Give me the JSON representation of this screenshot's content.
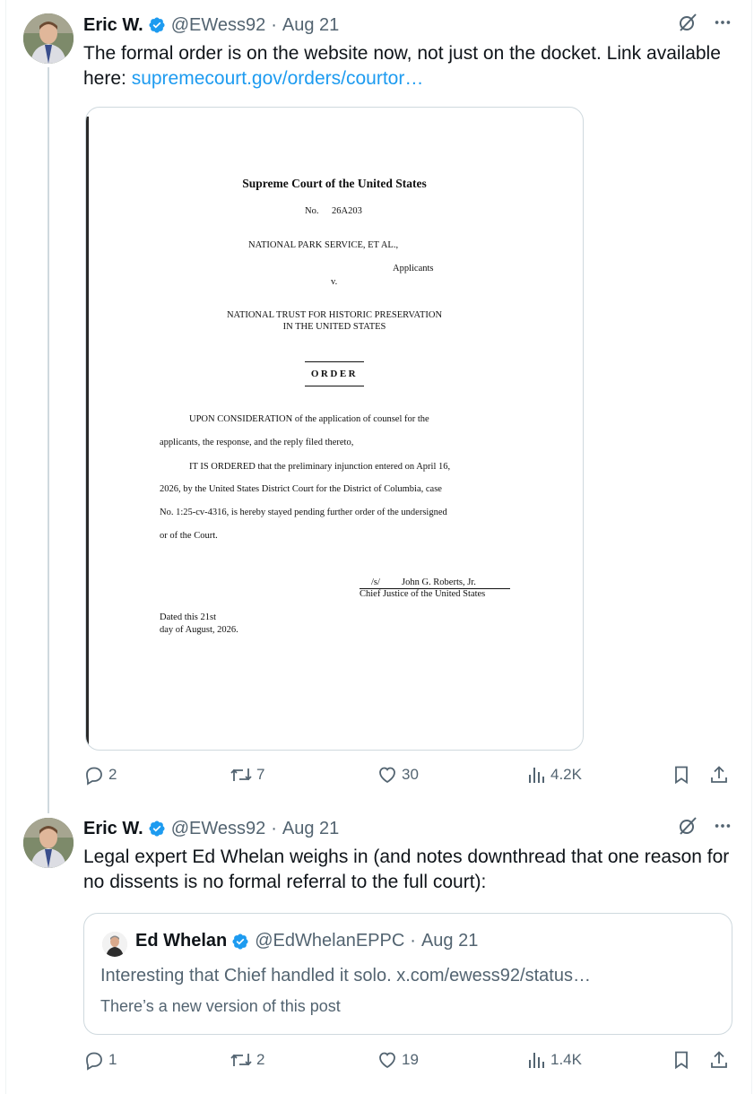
{
  "tweets": [
    {
      "author_name": "Eric W.",
      "handle": "@EWess92",
      "separator": "·",
      "date": "Aug 21",
      "text_pre": "The formal order is on the website now, not just on the docket. Link available here: ",
      "link": "supremecourt.gov/orders/courtor…",
      "stats": {
        "replies": "2",
        "reposts": "7",
        "likes": "30",
        "views": "4.2K"
      }
    },
    {
      "author_name": "Eric W.",
      "handle": "@EWess92",
      "separator": "·",
      "date": "Aug 21",
      "text": "Legal expert Ed Whelan weighs in (and notes downthread that one reason for no dissents is no formal referral to the full court):",
      "stats": {
        "replies": "1",
        "reposts": "2",
        "likes": "19",
        "views": "1.4K"
      }
    }
  ],
  "document": {
    "court": "Supreme Court of the United States",
    "no_label": "No.",
    "docket": "26A203",
    "applicant": "NATIONAL PARK SERVICE, ET AL.,",
    "applicants_label": "Applicants",
    "versus": "v.",
    "respondent_line1": "NATIONAL TRUST FOR HISTORIC PRESERVATION",
    "respondent_line2": "IN THE UNITED STATES",
    "order_title": "ORDER",
    "para1_line1": "UPON CONSIDERATION of the application of counsel for the",
    "para1_line2": "applicants, the response, and the reply filed thereto,",
    "para2_line1": "IT IS ORDERED that the preliminary injunction entered on April 16,",
    "para2_line2": "2026, by the United States District Court for the District of Columbia, case",
    "para2_line3": "No. 1:25-cv-4316, is hereby stayed pending further order of the undersigned",
    "para2_line4": "or of the Court.",
    "sig_mark": "/s/",
    "signer": "John G. Roberts, Jr.",
    "signer_title": "Chief Justice of the United States",
    "dated_line1": "Dated this 21st",
    "dated_line2": "day of August, 2026."
  },
  "quote": {
    "author_name": "Ed Whelan",
    "handle": "@EdWhelanEPPC",
    "separator": "·",
    "date": "Aug 21",
    "text": "Interesting that Chief handled it solo. x.com/ewess92/status…",
    "note": "There’s a new version of this post"
  },
  "icons": [
    "verified-badge-icon",
    "grok-icon",
    "more-icon",
    "reply-icon",
    "repost-icon",
    "like-icon",
    "views-icon",
    "bookmark-icon",
    "share-icon"
  ],
  "colors": {
    "link": "#1d9bf0",
    "verified": "#1d9bf0",
    "secondary_text": "#536471",
    "border": "#cfd9de"
  }
}
